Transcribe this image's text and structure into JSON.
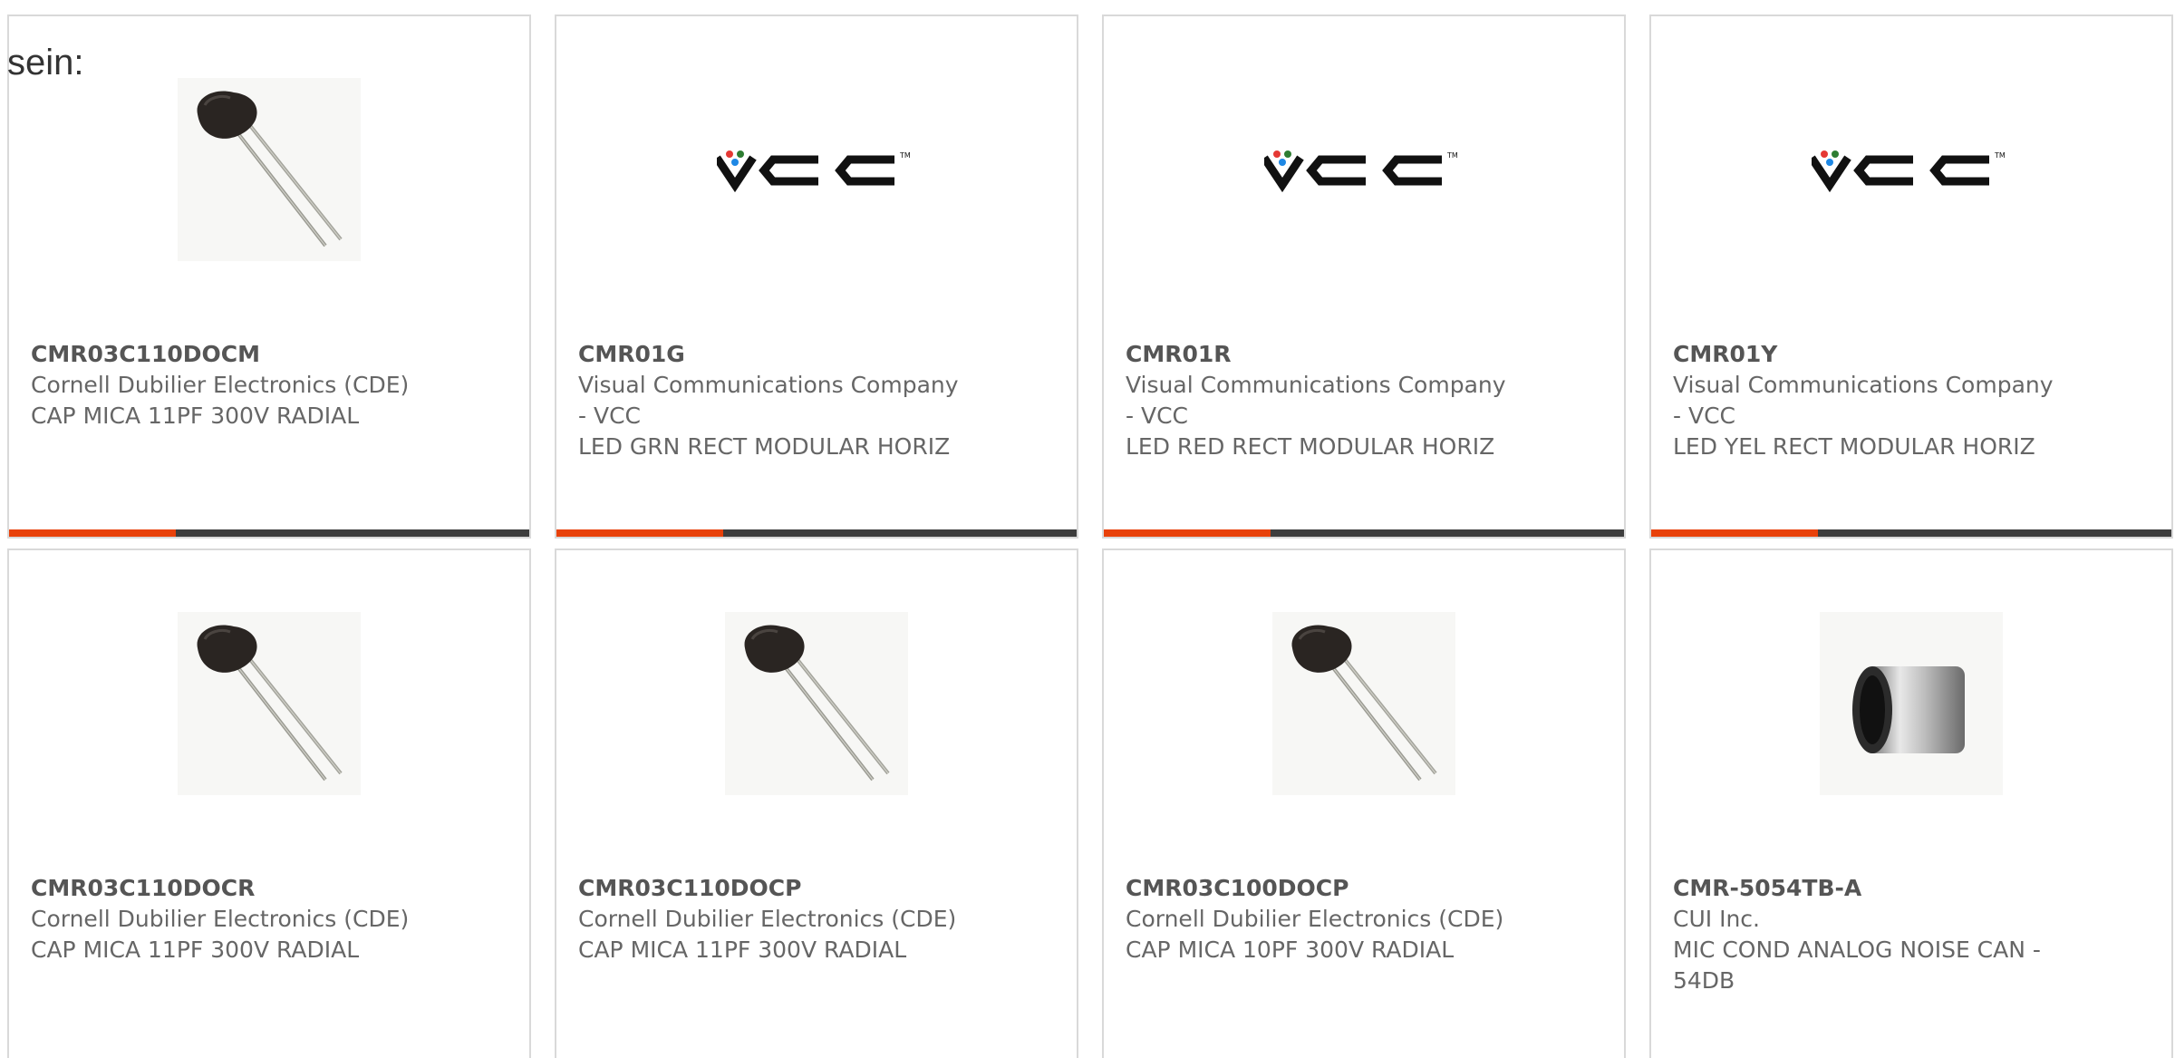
{
  "heading": "sein:",
  "colors": {
    "accent": "#e8410a",
    "bar": "#3d3d3d",
    "border": "#d9d9d9",
    "text": "#666666"
  },
  "cards": [
    {
      "part": "CMR03C110DOCM",
      "manufacturer": [
        "Cornell Dubilier Electronics (CDE)"
      ],
      "description": [
        "CAP MICA 11PF 300V RADIAL"
      ],
      "image": "capacitor-photo"
    },
    {
      "part": "CMR01G",
      "manufacturer": [
        "Visual Communications Company",
        "- VCC"
      ],
      "description": [
        "LED GRN RECT MODULAR HORIZ"
      ],
      "image": "vcc-logo",
      "logo_text": "TM"
    },
    {
      "part": "CMR01R",
      "manufacturer": [
        "Visual Communications Company",
        "- VCC"
      ],
      "description": [
        "LED RED RECT MODULAR HORIZ"
      ],
      "image": "vcc-logo",
      "logo_text": "TM"
    },
    {
      "part": "CMR01Y",
      "manufacturer": [
        "Visual Communications Company",
        "- VCC"
      ],
      "description": [
        "LED YEL RECT MODULAR HORIZ"
      ],
      "image": "vcc-logo",
      "logo_text": "TM"
    },
    {
      "part": "CMR03C110DOCR",
      "manufacturer": [
        "Cornell Dubilier Electronics (CDE)"
      ],
      "description": [
        "CAP MICA 11PF 300V RADIAL"
      ],
      "image": "capacitor-photo"
    },
    {
      "part": "CMR03C110DOCP",
      "manufacturer": [
        "Cornell Dubilier Electronics (CDE)"
      ],
      "description": [
        "CAP MICA 11PF 300V RADIAL"
      ],
      "image": "capacitor-photo"
    },
    {
      "part": "CMR03C100DOCP",
      "manufacturer": [
        "Cornell Dubilier Electronics (CDE)"
      ],
      "description": [
        "CAP MICA 10PF 300V RADIAL"
      ],
      "image": "capacitor-photo"
    },
    {
      "part": "CMR-5054TB-A",
      "manufacturer": [
        "CUI Inc."
      ],
      "description": [
        "MIC COND ANALOG NOISE CAN -",
        "54DB"
      ],
      "image": "microphone-photo"
    }
  ]
}
